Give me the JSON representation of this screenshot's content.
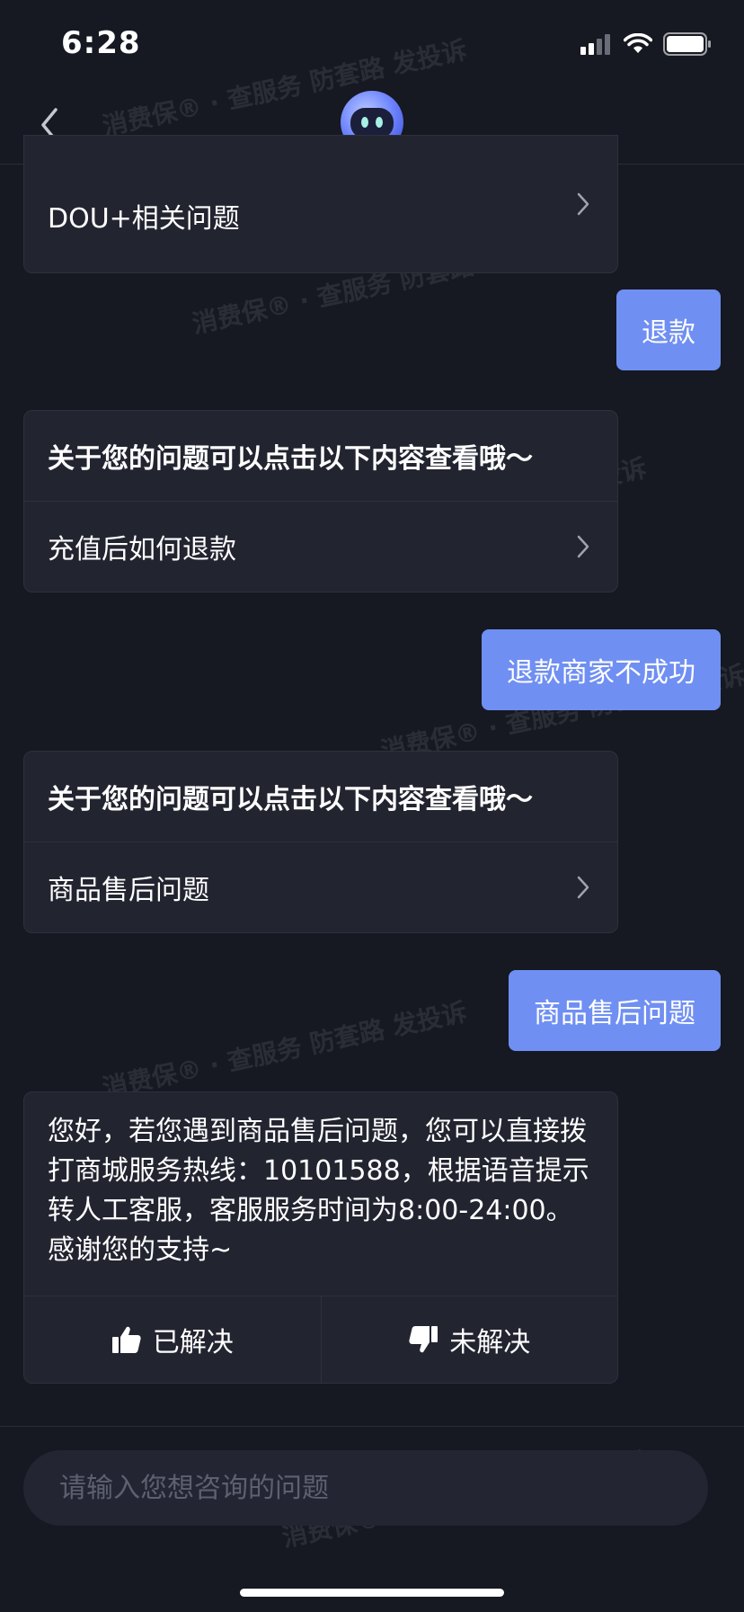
{
  "status": {
    "time": "6:28"
  },
  "chat": {
    "card1": {
      "item": "DOU+相关问题"
    },
    "user1": "退款",
    "card2": {
      "title": "关于您的问题可以点击以下内容查看哦～",
      "item": "充值后如何退款"
    },
    "user2": "退款商家不成功",
    "card3": {
      "title": "关于您的问题可以点击以下内容查看哦～",
      "item": "商品售后问题"
    },
    "user3": "商品售后问题",
    "answer": {
      "text": "您好，若您遇到商品售后问题，您可以直接拨打商城服务热线：10101588，根据语音提示转人工客服，客服服务时间为8:00-24:00。感谢您的支持~",
      "resolved": "已解决",
      "unresolved": "未解决"
    }
  },
  "input": {
    "placeholder": "请输入您想咨询的问题"
  },
  "watermark": "消费保® · 查服务 防套路 发投诉",
  "colors": {
    "background": "#161822",
    "card": "#222430",
    "user_bubble": "#6f8ff2"
  }
}
